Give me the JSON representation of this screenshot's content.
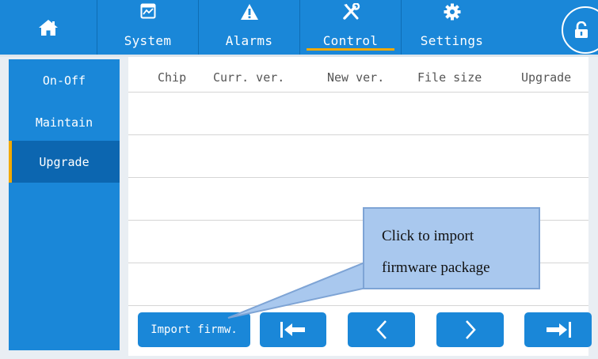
{
  "header": {
    "home_icon": "home-icon",
    "tabs": [
      {
        "label": "System",
        "icon": "chart-window-icon"
      },
      {
        "label": "Alarms",
        "icon": "warning-icon"
      },
      {
        "label": "Control",
        "icon": "tools-icon",
        "active": true
      },
      {
        "label": "Settings",
        "icon": "gear-icon"
      }
    ],
    "lock_icon": "unlock-icon",
    "accent_color": "#1a87d8",
    "active_indicator_color": "#f2a900"
  },
  "sidebar": {
    "items": [
      {
        "label": "On-Off"
      },
      {
        "label": "Maintain"
      },
      {
        "label": "Upgrade",
        "active": true
      }
    ]
  },
  "table": {
    "columns": [
      "Chip",
      "Curr. ver.",
      "New ver.",
      "File size",
      "Upgrade"
    ],
    "rows": []
  },
  "buttons": {
    "import_label": "Import firmw.",
    "first_icon": "first-page-icon",
    "prev_icon": "prev-page-icon",
    "next_icon": "next-page-icon",
    "last_icon": "last-page-icon"
  },
  "callout": {
    "line1": "Click to import",
    "line2": "firmware package"
  }
}
